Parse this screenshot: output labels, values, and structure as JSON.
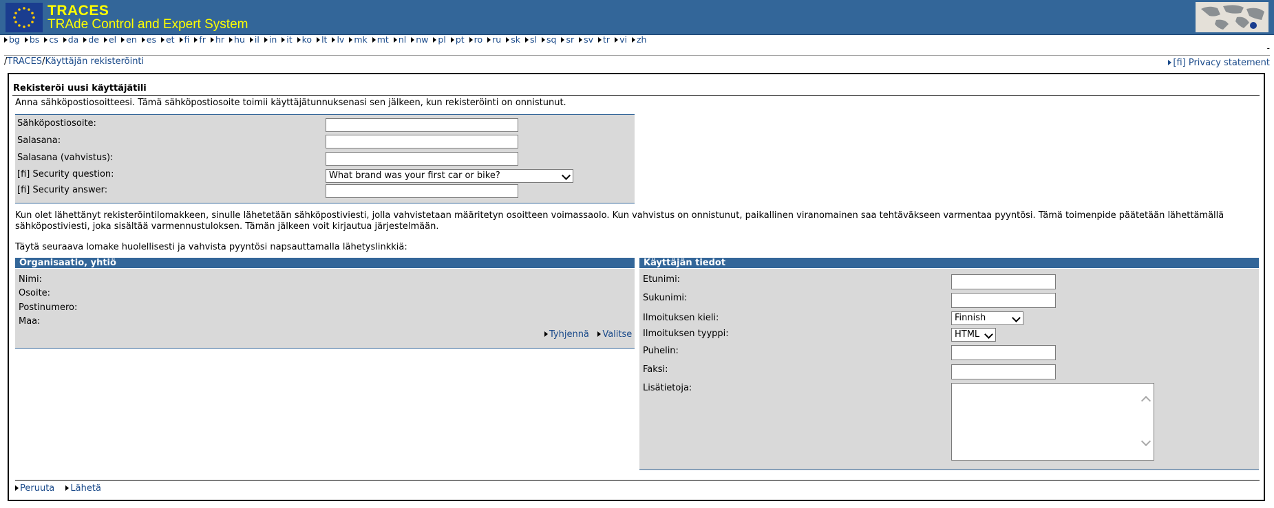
{
  "header": {
    "title": "TRACES",
    "subtitle": "TRAde Control and Expert System"
  },
  "languages": [
    "bg",
    "bs",
    "cs",
    "da",
    "de",
    "el",
    "en",
    "es",
    "et",
    "fi",
    "fr",
    "hr",
    "hu",
    "il",
    "in",
    "it",
    "ko",
    "lt",
    "lv",
    "mk",
    "mt",
    "nl",
    "nw",
    "pl",
    "pt",
    "ro",
    "ru",
    "sk",
    "sl",
    "sq",
    "sr",
    "sv",
    "tr",
    "vi",
    "zh"
  ],
  "header_dash": "-",
  "breadcrumb": {
    "sep": "/",
    "root": "TRACES",
    "current": "Käyttäjän rekisteröinti"
  },
  "privacy_link": "[fi] Privacy statement",
  "registration": {
    "title": "Rekisteröi uusi käyttäjätili",
    "intro": "Anna sähköpostiosoitteesi. Tämä sähköpostiosoite toimii käyttäjätunnuksenasi sen jälkeen, kun rekisteröinti on onnistunut.",
    "email_label": "Sähköpostiosoite:",
    "password_label": "Salasana:",
    "password_confirm_label": "Salasana (vahvistus):",
    "security_question_label": "[fi] Security question:",
    "security_question_value": "What brand was your first car or bike?",
    "security_answer_label": "[fi] Security answer:"
  },
  "info_text": "Kun olet lähettänyt rekisteröintilomakkeen, sinulle lähetetään sähköpostiviesti, jolla vahvistetaan määritetyn osoitteen voimassaolo. Kun vahvistus on onnistunut, paikallinen viranomainen saa tehtäväkseen varmentaa pyyntösi. Tämä toimenpide päätetään lähettämällä sähköpostiviesti, joka sisältää varmennustuloksen. Tämän jälkeen voit kirjautua järjestelmään.",
  "instruction_text": "Täytä seuraava lomake huolellisesti ja vahvista pyyntösi napsauttamalla lähetyslinkkiä:",
  "organisation": {
    "title": "Organisaatio, yhtiö",
    "name_label": "Nimi:",
    "address_label": "Osoite:",
    "postcode_label": "Postinumero:",
    "country_label": "Maa:",
    "clear_link": "Tyhjennä",
    "select_link": "Valitse"
  },
  "user": {
    "title": "Käyttäjän tiedot",
    "firstname_label": "Etunimi:",
    "lastname_label": "Sukunimi:",
    "language_label": "Ilmoituksen kieli:",
    "language_value": "Finnish",
    "type_label": "Ilmoituksen tyyppi:",
    "type_value": "HTML",
    "phone_label": "Puhelin:",
    "fax_label": "Faksi:",
    "notes_label": "Lisätietoja:"
  },
  "footer": {
    "cancel_link": "Peruuta",
    "submit_link": "Lähetä"
  }
}
